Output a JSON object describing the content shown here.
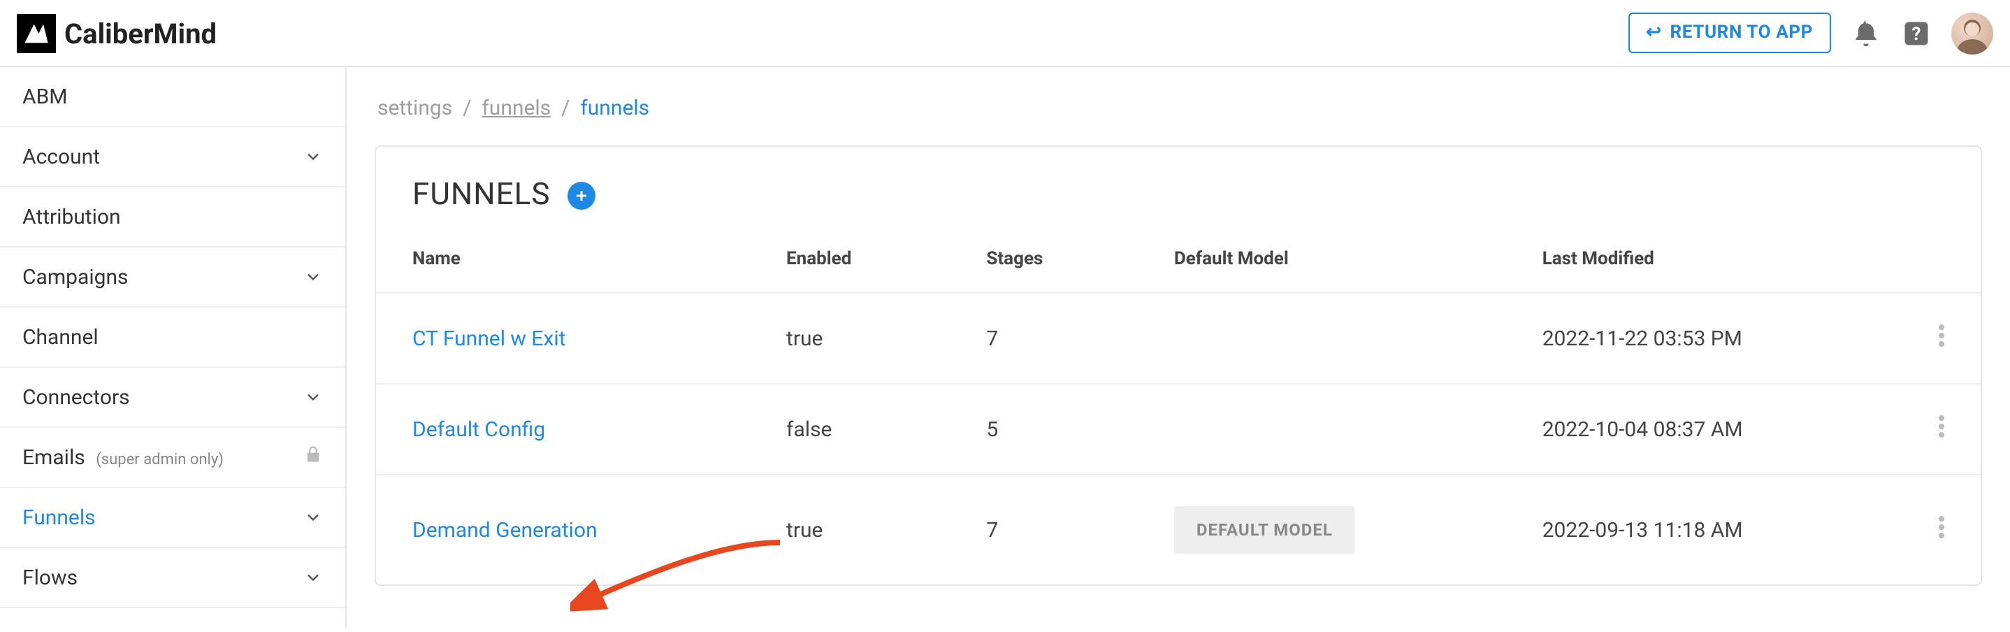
{
  "brand": "CaliberMind",
  "header": {
    "return_label": "RETURN TO APP"
  },
  "sidebar": {
    "items": [
      {
        "label": "ABM",
        "expandable": false
      },
      {
        "label": "Account",
        "expandable": true
      },
      {
        "label": "Attribution",
        "expandable": false
      },
      {
        "label": "Campaigns",
        "expandable": true
      },
      {
        "label": "Channel",
        "expandable": false
      },
      {
        "label": "Connectors",
        "expandable": true
      },
      {
        "label": "Emails",
        "note": "(super admin only)",
        "locked": true
      },
      {
        "label": "Funnels",
        "expandable": true,
        "active": true
      },
      {
        "label": "Flows",
        "expandable": true
      }
    ]
  },
  "breadcrumbs": {
    "root": "settings",
    "mid": "funnels",
    "current": "funnels"
  },
  "page": {
    "title": "FUNNELS"
  },
  "table": {
    "columns": {
      "name": "Name",
      "enabled": "Enabled",
      "stages": "Stages",
      "default_model": "Default Model",
      "last_modified": "Last Modified"
    },
    "rows": [
      {
        "name": "CT Funnel w Exit",
        "enabled": "true",
        "stages": "7",
        "default_model": "",
        "last_modified": "2022-11-22 03:53 PM"
      },
      {
        "name": "Default Config",
        "enabled": "false",
        "stages": "5",
        "default_model": "",
        "last_modified": "2022-10-04 08:37 AM"
      },
      {
        "name": "Demand Generation",
        "enabled": "true",
        "stages": "7",
        "default_model": "DEFAULT MODEL",
        "last_modified": "2022-09-13 11:18 AM"
      }
    ]
  }
}
